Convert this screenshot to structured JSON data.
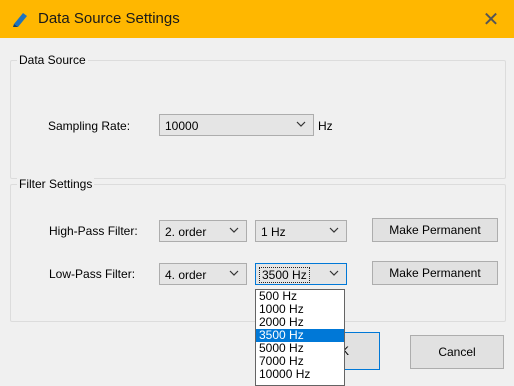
{
  "window": {
    "title": "Data Source Settings",
    "close_glyph": "✕"
  },
  "data_source": {
    "legend": "Data Source",
    "sampling_label": "Sampling Rate:",
    "sampling_value": "10000",
    "sampling_unit": "Hz"
  },
  "filter": {
    "legend": "Filter Settings",
    "hp_label": "High-Pass Filter:",
    "hp_order": "2. order",
    "hp_freq": "1 Hz",
    "lp_label": "Low-Pass Filter:",
    "lp_order": "4. order",
    "lp_freq": "3500 Hz",
    "make_permanent": "Make Permanent"
  },
  "dropdown_options": [
    "500 Hz",
    "1000 Hz",
    "2000 Hz",
    "3500 Hz",
    "5000 Hz",
    "7000 Hz",
    "10000 Hz"
  ],
  "dropdown_selected": "3500 Hz",
  "buttons": {
    "ok_partial": "K",
    "cancel": "Cancel"
  },
  "colors": {
    "titlebar": "#ffb700",
    "selection": "#0078d7"
  },
  "icons": [
    "app-pencil-icon",
    "close-icon",
    "chevron-down-icon"
  ]
}
